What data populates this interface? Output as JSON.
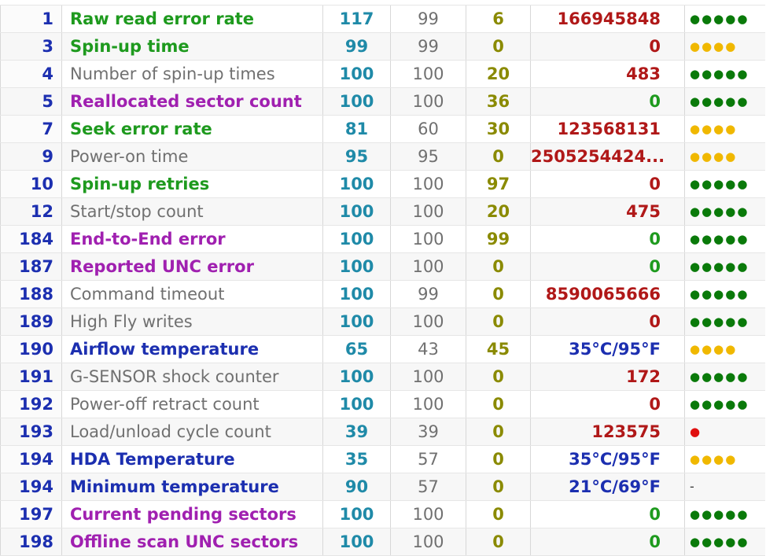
{
  "colors": {
    "id": "#1c2fb0",
    "current": "#1f8aa8",
    "worst": "#707070",
    "threshold": "#8a8a00",
    "raw_red": "#b01818",
    "raw_green": "#1e9a1e",
    "raw_blue": "#1c2fb0",
    "health_good": "#0a7a0a",
    "health_warn": "#f0b800",
    "health_bad": "#e01010"
  },
  "attributes": [
    {
      "id": "1",
      "name": "Raw read error rate",
      "name_color": "green",
      "current": "117",
      "worst": "99",
      "threshold": "6",
      "raw": "166945848",
      "raw_color": "red",
      "health": "●●●●●",
      "health_level": "good"
    },
    {
      "id": "3",
      "name": "Spin-up time",
      "name_color": "green",
      "current": "99",
      "worst": "99",
      "threshold": "0",
      "raw": "0",
      "raw_color": "red",
      "health": "●●●●",
      "health_level": "warn"
    },
    {
      "id": "4",
      "name": "Number of spin-up times",
      "name_color": "gray",
      "current": "100",
      "worst": "100",
      "threshold": "20",
      "raw": "483",
      "raw_color": "red",
      "health": "●●●●●",
      "health_level": "good"
    },
    {
      "id": "5",
      "name": "Reallocated sector count",
      "name_color": "purple",
      "current": "100",
      "worst": "100",
      "threshold": "36",
      "raw": "0",
      "raw_color": "green",
      "health": "●●●●●",
      "health_level": "good"
    },
    {
      "id": "7",
      "name": "Seek error rate",
      "name_color": "green",
      "current": "81",
      "worst": "60",
      "threshold": "30",
      "raw": "123568131",
      "raw_color": "red",
      "health": "●●●●",
      "health_level": "warn"
    },
    {
      "id": "9",
      "name": "Power-on time",
      "name_color": "gray",
      "current": "95",
      "worst": "95",
      "threshold": "0",
      "raw": "2505254424...",
      "raw_color": "red",
      "health": "●●●●",
      "health_level": "warn"
    },
    {
      "id": "10",
      "name": "Spin-up retries",
      "name_color": "green",
      "current": "100",
      "worst": "100",
      "threshold": "97",
      "raw": "0",
      "raw_color": "red",
      "health": "●●●●●",
      "health_level": "good"
    },
    {
      "id": "12",
      "name": "Start/stop count",
      "name_color": "gray",
      "current": "100",
      "worst": "100",
      "threshold": "20",
      "raw": "475",
      "raw_color": "red",
      "health": "●●●●●",
      "health_level": "good"
    },
    {
      "id": "184",
      "name": "End-to-End error",
      "name_color": "purple",
      "current": "100",
      "worst": "100",
      "threshold": "99",
      "raw": "0",
      "raw_color": "green",
      "health": "●●●●●",
      "health_level": "good"
    },
    {
      "id": "187",
      "name": "Reported UNC error",
      "name_color": "purple",
      "current": "100",
      "worst": "100",
      "threshold": "0",
      "raw": "0",
      "raw_color": "green",
      "health": "●●●●●",
      "health_level": "good"
    },
    {
      "id": "188",
      "name": "Command timeout",
      "name_color": "gray",
      "current": "100",
      "worst": "99",
      "threshold": "0",
      "raw": "8590065666",
      "raw_color": "red",
      "health": "●●●●●",
      "health_level": "good"
    },
    {
      "id": "189",
      "name": "High Fly writes",
      "name_color": "gray",
      "current": "100",
      "worst": "100",
      "threshold": "0",
      "raw": "0",
      "raw_color": "red",
      "health": "●●●●●",
      "health_level": "good"
    },
    {
      "id": "190",
      "name": "Airflow temperature",
      "name_color": "blue",
      "current": "65",
      "worst": "43",
      "threshold": "45",
      "raw": "35°C/95°F",
      "raw_color": "blue",
      "health": "●●●●",
      "health_level": "warn"
    },
    {
      "id": "191",
      "name": "G-SENSOR shock counter",
      "name_color": "gray",
      "current": "100",
      "worst": "100",
      "threshold": "0",
      "raw": "172",
      "raw_color": "red",
      "health": "●●●●●",
      "health_level": "good"
    },
    {
      "id": "192",
      "name": "Power-off retract count",
      "name_color": "gray",
      "current": "100",
      "worst": "100",
      "threshold": "0",
      "raw": "0",
      "raw_color": "red",
      "health": "●●●●●",
      "health_level": "good"
    },
    {
      "id": "193",
      "name": "Load/unload cycle count",
      "name_color": "gray",
      "current": "39",
      "worst": "39",
      "threshold": "0",
      "raw": "123575",
      "raw_color": "red",
      "health": "●",
      "health_level": "bad"
    },
    {
      "id": "194",
      "name": "HDA Temperature",
      "name_color": "blue",
      "current": "35",
      "worst": "57",
      "threshold": "0",
      "raw": "35°C/95°F",
      "raw_color": "blue",
      "health": "●●●●",
      "health_level": "warn"
    },
    {
      "id": "194",
      "name": "Minimum temperature",
      "name_color": "blue",
      "current": "90",
      "worst": "57",
      "threshold": "0",
      "raw": "21°C/69°F",
      "raw_color": "blue",
      "health": "-",
      "health_level": "none"
    },
    {
      "id": "197",
      "name": "Current pending sectors",
      "name_color": "purple",
      "current": "100",
      "worst": "100",
      "threshold": "0",
      "raw": "0",
      "raw_color": "green",
      "health": "●●●●●",
      "health_level": "good"
    },
    {
      "id": "198",
      "name": "Offline scan UNC sectors",
      "name_color": "purple",
      "current": "100",
      "worst": "100",
      "threshold": "0",
      "raw": "0",
      "raw_color": "green",
      "health": "●●●●●",
      "health_level": "good"
    }
  ]
}
